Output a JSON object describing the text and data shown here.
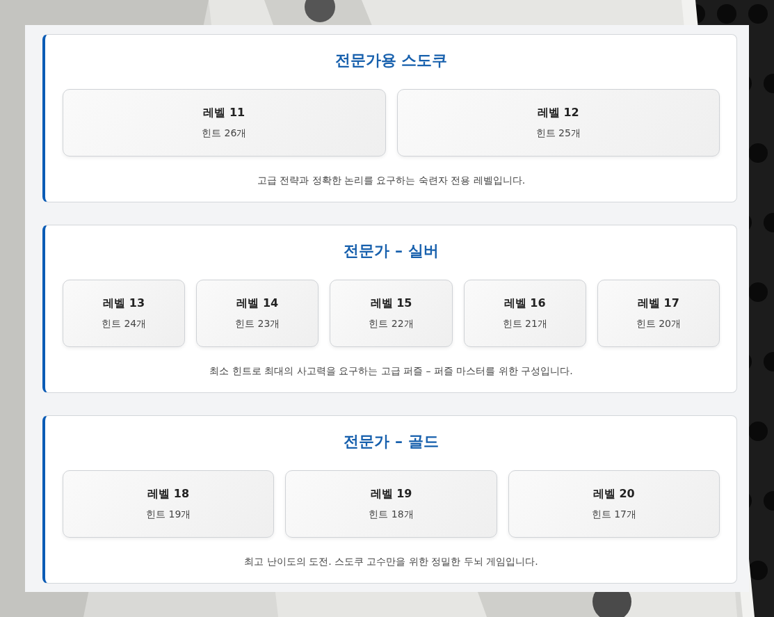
{
  "sections": [
    {
      "title": "전문가용 스도쿠",
      "levels": [
        {
          "name": "레벨 11",
          "hints": "힌트 26개"
        },
        {
          "name": "레벨 12",
          "hints": "힌트 25개"
        }
      ],
      "description": "고급 전략과 정확한 논리를 요구하는 숙련자 전용 레벨입니다."
    },
    {
      "title": "전문가 – 실버",
      "levels": [
        {
          "name": "레벨 13",
          "hints": "힌트 24개"
        },
        {
          "name": "레벨 14",
          "hints": "힌트 23개"
        },
        {
          "name": "레벨 15",
          "hints": "힌트 22개"
        },
        {
          "name": "레벨 16",
          "hints": "힌트 21개"
        },
        {
          "name": "레벨 17",
          "hints": "힌트 20개"
        }
      ],
      "description": "최소 힌트로 최대의 사고력을 요구하는 고급 퍼즐 – 퍼즐 마스터를 위한 구성입니다."
    },
    {
      "title": "전문가 – 골드",
      "levels": [
        {
          "name": "레벨 18",
          "hints": "힌트 19개"
        },
        {
          "name": "레벨 19",
          "hints": "힌트 18개"
        },
        {
          "name": "레벨 20",
          "hints": "힌트 17개"
        }
      ],
      "description": "최고 난이도의 도전. 스도쿠 고수만을 위한 정밀한 두뇌 게임입니다."
    }
  ]
}
